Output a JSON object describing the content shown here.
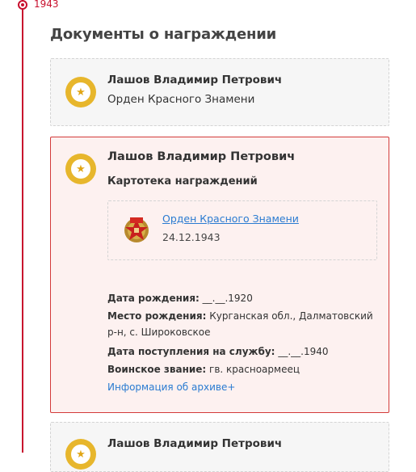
{
  "timeline": {
    "year": "1943"
  },
  "section": {
    "title": "Документы о награждении"
  },
  "cards": [
    {
      "name": "Лашов Владимир Петрович",
      "award": "Орден Красного Знамени"
    },
    {
      "name": "Лашов Владимир Петрович",
      "subtitle": "Картотека награждений",
      "order": {
        "link": "Орден Красного Знамени",
        "date": "24.12.1943"
      },
      "details": {
        "birth_date_label": "Дата рождения:",
        "birth_date_value": "__.__.1920",
        "birth_place_label": "Место рождения:",
        "birth_place_value": "Курганская обл., Далматовский р-н, с. Широковское",
        "service_date_label": "Дата поступления на службу:",
        "service_date_value": "__.__.1940",
        "rank_label": "Воинское звание:",
        "rank_value": "гв. красноармеец"
      },
      "archive_link": "Информация об архиве+"
    },
    {
      "name": "Лашов Владимир Петрович"
    }
  ],
  "colors": {
    "accent": "#c8102e",
    "medal": "#e7b62c",
    "link": "#2a7bd1",
    "highlight_bg": "#fdf1f0"
  },
  "icons": {
    "medal": "medal-star-icon",
    "order": "order-red-banner-icon"
  }
}
